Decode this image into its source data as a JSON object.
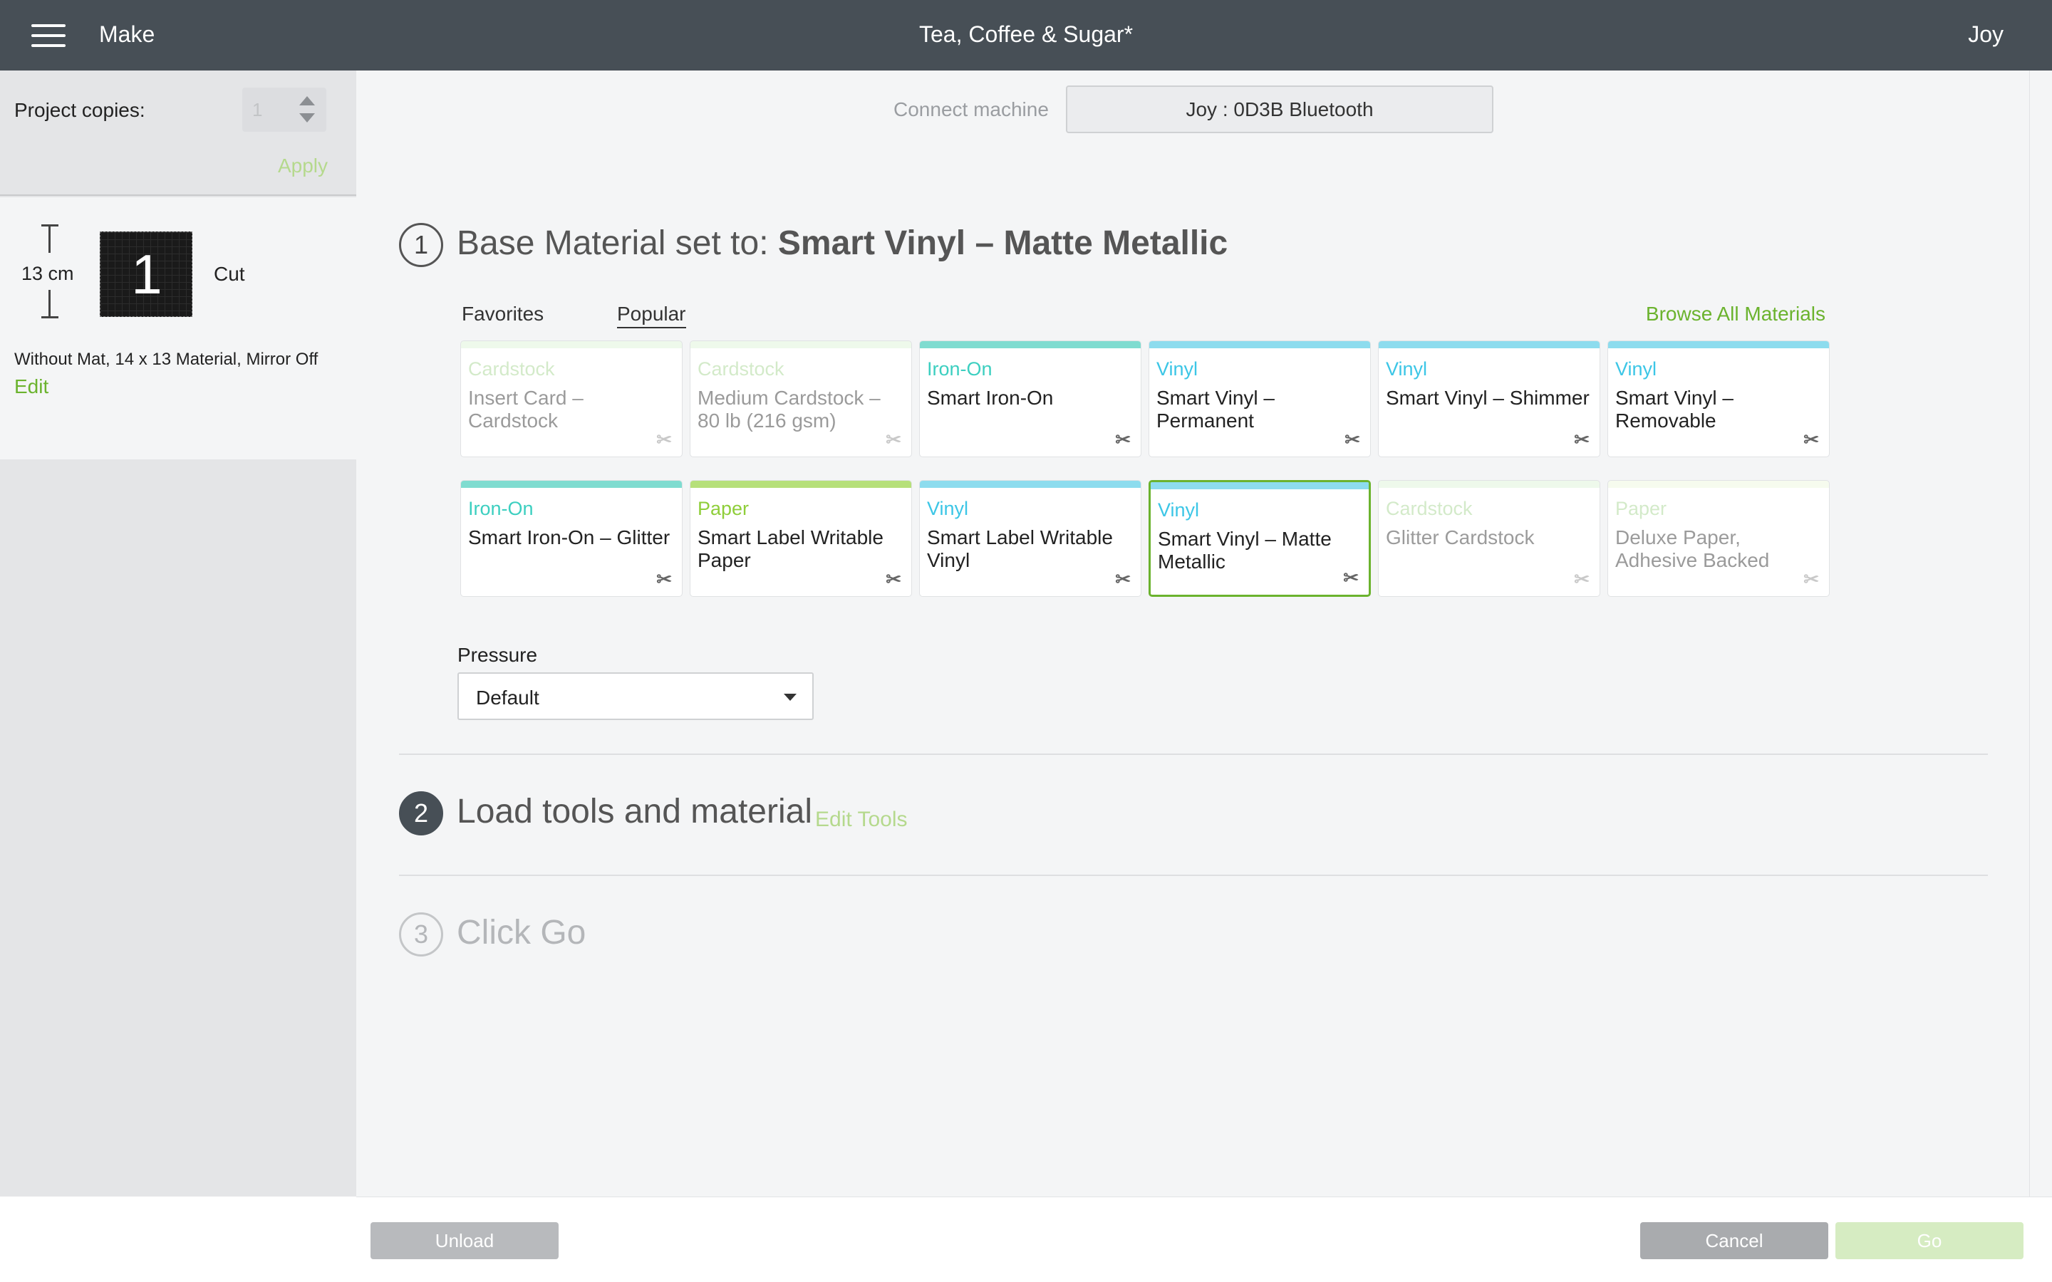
{
  "header": {
    "mode_label": "Make",
    "project_title": "Tea, Coffee & Sugar*",
    "user_name": "Joy"
  },
  "sidebar": {
    "copies_label": "Project copies:",
    "copies_value": "1",
    "apply_label": "Apply",
    "mat": {
      "dimension": "13 cm",
      "number": "1",
      "action": "Cut",
      "description": "Without Mat, 14 x 13 Material, Mirror Off",
      "edit_label": "Edit"
    }
  },
  "machine": {
    "connect_label": "Connect machine",
    "device": "Joy : 0D3B Bluetooth"
  },
  "step1": {
    "number": "1",
    "prefix": "Base Material set to: ",
    "material": "Smart Vinyl – Matte Metallic",
    "tabs": [
      "Favorites",
      "Popular"
    ],
    "active_tab": "Popular",
    "browse_label": "Browse All Materials",
    "cards": [
      {
        "category": "Cardstock",
        "name": "Insert Card – Cardstock",
        "color": "#cfeec7",
        "faded": true,
        "selected": false
      },
      {
        "category": "Cardstock",
        "name": "Medium Cardstock – 80 lb (216 gsm)",
        "color": "#cfeec7",
        "faded": true,
        "selected": false
      },
      {
        "category": "Iron-On",
        "name": "Smart Iron-On",
        "color": "#7fdcd0",
        "faded": false,
        "selected": false
      },
      {
        "category": "Vinyl",
        "name": "Smart Vinyl – Permanent",
        "color": "#8ddcee",
        "faded": false,
        "selected": false
      },
      {
        "category": "Vinyl",
        "name": "Smart Vinyl – Shimmer",
        "color": "#8ddcee",
        "faded": false,
        "selected": false
      },
      {
        "category": "Vinyl",
        "name": "Smart Vinyl – Removable",
        "color": "#8ddcee",
        "faded": false,
        "selected": false
      },
      {
        "category": "Iron-On",
        "name": "Smart Iron-On – Glitter",
        "color": "#7fdcd0",
        "faded": false,
        "selected": false
      },
      {
        "category": "Paper",
        "name": "Smart Label Writable Paper",
        "color": "#b6e07a",
        "faded": false,
        "selected": false
      },
      {
        "category": "Vinyl",
        "name": "Smart Label Writable Vinyl",
        "color": "#8ddcee",
        "faded": false,
        "selected": false
      },
      {
        "category": "Vinyl",
        "name": "Smart Vinyl – Matte Metallic",
        "color": "#8ddcee",
        "faded": false,
        "selected": true
      },
      {
        "category": "Cardstock",
        "name": "Glitter Cardstock",
        "color": "#cfeec7",
        "faded": true,
        "selected": false
      },
      {
        "category": "Paper",
        "name": "Deluxe Paper, Adhesive Backed",
        "color": "#e6f4cf",
        "faded": true,
        "selected": false
      }
    ],
    "pressure_label": "Pressure",
    "pressure_value": "Default"
  },
  "step2": {
    "number": "2",
    "title": "Load tools and material",
    "edit_tools_label": "Edit Tools"
  },
  "step3": {
    "number": "3",
    "title": "Click Go"
  },
  "footer": {
    "unload_label": "Unload",
    "cancel_label": "Cancel",
    "go_label": "Go"
  },
  "colors": {
    "topbar": "#474f56",
    "accent_green": "#6bb32e",
    "iron_on": "#3ccfc0",
    "vinyl": "#3cc6e6",
    "paper": "#8fce3a"
  }
}
